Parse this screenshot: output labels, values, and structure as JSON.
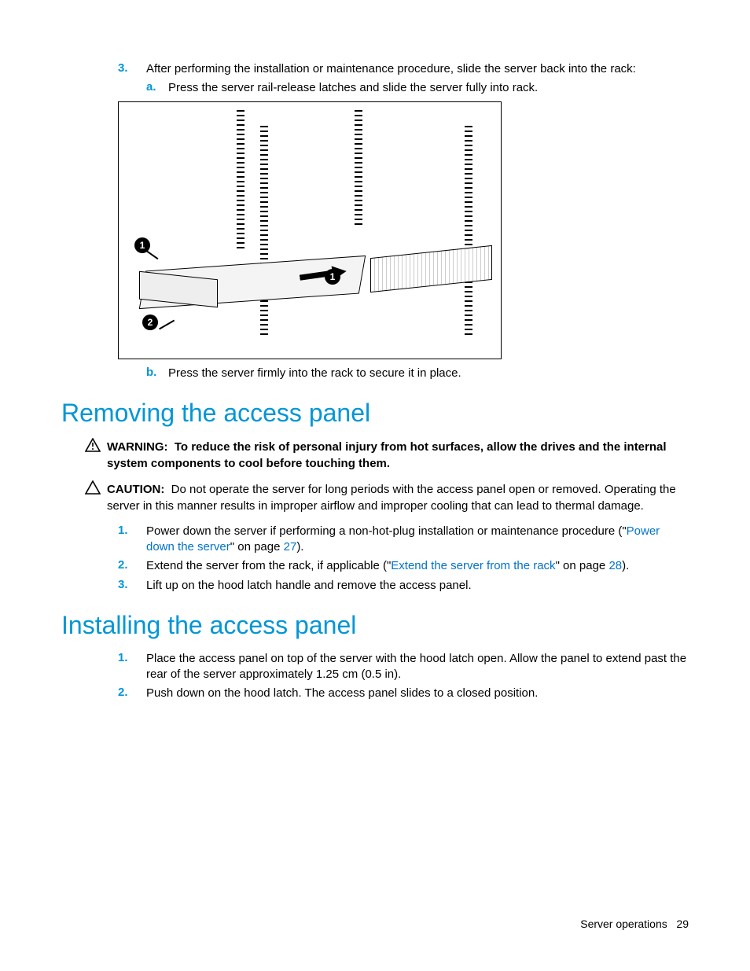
{
  "top": {
    "step3_marker": "3.",
    "step3_text": "After performing the installation or maintenance procedure, slide the server back into the rack:",
    "sub_a_marker": "a.",
    "sub_a_text": "Press the server rail-release latches and slide the server fully into rack.",
    "sub_b_marker": "b.",
    "sub_b_text": "Press the server firmly into the rack to secure it in place.",
    "callout1": "1",
    "callout2": "2"
  },
  "sec1": {
    "heading": "Removing the access panel",
    "warning_label": "WARNING:",
    "warning_text": "To reduce the risk of personal injury from hot surfaces, allow the drives and the internal system components to cool before touching them.",
    "caution_label": "CAUTION:",
    "caution_text": "Do not operate the server for long periods with the access panel open or removed. Operating the server in this manner results in improper airflow and improper cooling that can lead to thermal damage.",
    "steps": [
      {
        "m": "1.",
        "pre": "Power down the server if performing a non-hot-plug installation or maintenance procedure (\"",
        "link": "Power down the server",
        "mid": "\" on page ",
        "page": "27",
        "post": ")."
      },
      {
        "m": "2.",
        "pre": "Extend the server from the rack, if applicable (\"",
        "link": "Extend the server from the rack",
        "mid": "\" on page ",
        "page": "28",
        "post": ")."
      },
      {
        "m": "3.",
        "pre": "Lift up on the hood latch handle and remove the access panel.",
        "link": "",
        "mid": "",
        "page": "",
        "post": ""
      }
    ]
  },
  "sec2": {
    "heading": "Installing the access panel",
    "steps": [
      {
        "m": "1.",
        "text": "Place the access panel on top of the server with the hood latch open. Allow the panel to extend past the rear of the server approximately 1.25 cm (0.5 in)."
      },
      {
        "m": "2.",
        "text": "Push down on the hood latch. The access panel slides to a closed position."
      }
    ]
  },
  "footer": {
    "section": "Server operations",
    "page": "29"
  }
}
